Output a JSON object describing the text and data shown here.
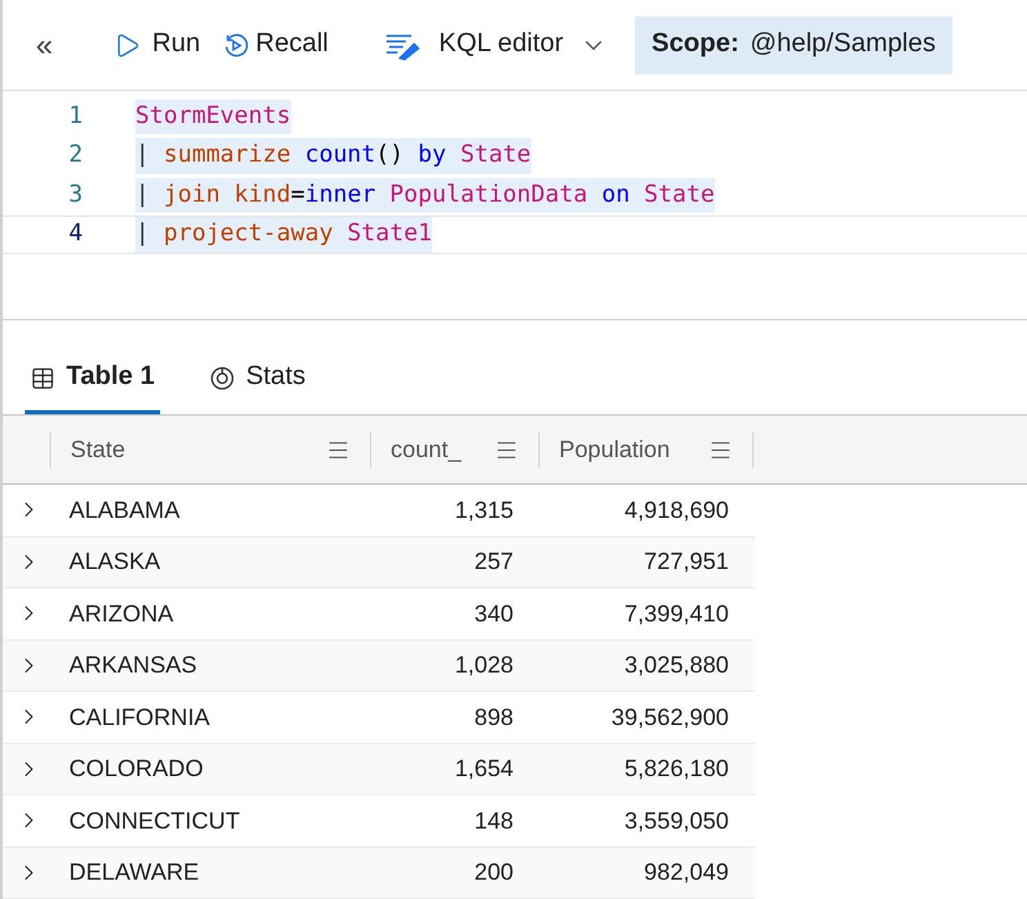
{
  "toolbar": {
    "collapse": "«",
    "run": "Run",
    "recall": "Recall",
    "editor_mode": "KQL editor",
    "scope_label": "Scope:",
    "scope_value": "@help/Samples"
  },
  "editor": {
    "lines": [
      {
        "number": "1",
        "current": false,
        "tokens": [
          {
            "kind": "table",
            "text": "StormEvents"
          }
        ]
      },
      {
        "number": "2",
        "current": false,
        "tokens": [
          {
            "kind": "pipe",
            "text": "| "
          },
          {
            "kind": "operator",
            "text": "summarize "
          },
          {
            "kind": "function",
            "text": "count"
          },
          {
            "kind": "plain",
            "text": "() "
          },
          {
            "kind": "function",
            "text": "by "
          },
          {
            "kind": "table",
            "text": "State"
          }
        ]
      },
      {
        "number": "3",
        "current": false,
        "tokens": [
          {
            "kind": "pipe",
            "text": "| "
          },
          {
            "kind": "operator",
            "text": "join "
          },
          {
            "kind": "operator",
            "text": "kind"
          },
          {
            "kind": "plain",
            "text": "="
          },
          {
            "kind": "function",
            "text": "inner "
          },
          {
            "kind": "table",
            "text": "PopulationData "
          },
          {
            "kind": "function",
            "text": "on "
          },
          {
            "kind": "table",
            "text": "State"
          }
        ]
      },
      {
        "number": "4",
        "current": true,
        "tokens": [
          {
            "kind": "pipe",
            "text": "| "
          },
          {
            "kind": "operator",
            "text": "project-away "
          },
          {
            "kind": "table",
            "text": "State1"
          }
        ]
      }
    ]
  },
  "tabs": [
    {
      "label": "Table 1",
      "kind": "table",
      "selected": true
    },
    {
      "label": "Stats",
      "kind": "stats",
      "selected": false
    }
  ],
  "table": {
    "columns": [
      "State",
      "count_",
      "Population"
    ],
    "rows": [
      {
        "cells": [
          "ALABAMA",
          "1,315",
          "4,918,690"
        ]
      },
      {
        "cells": [
          "ALASKA",
          "257",
          "727,951"
        ]
      },
      {
        "cells": [
          "ARIZONA",
          "340",
          "7,399,410"
        ]
      },
      {
        "cells": [
          "ARKANSAS",
          "1,028",
          "3,025,880"
        ]
      },
      {
        "cells": [
          "CALIFORNIA",
          "898",
          "39,562,900"
        ]
      },
      {
        "cells": [
          "COLORADO",
          "1,654",
          "5,826,180"
        ]
      },
      {
        "cells": [
          "CONNECTICUT",
          "148",
          "3,559,050"
        ]
      },
      {
        "cells": [
          "DELAWARE",
          "200",
          "982,049"
        ]
      }
    ]
  }
}
